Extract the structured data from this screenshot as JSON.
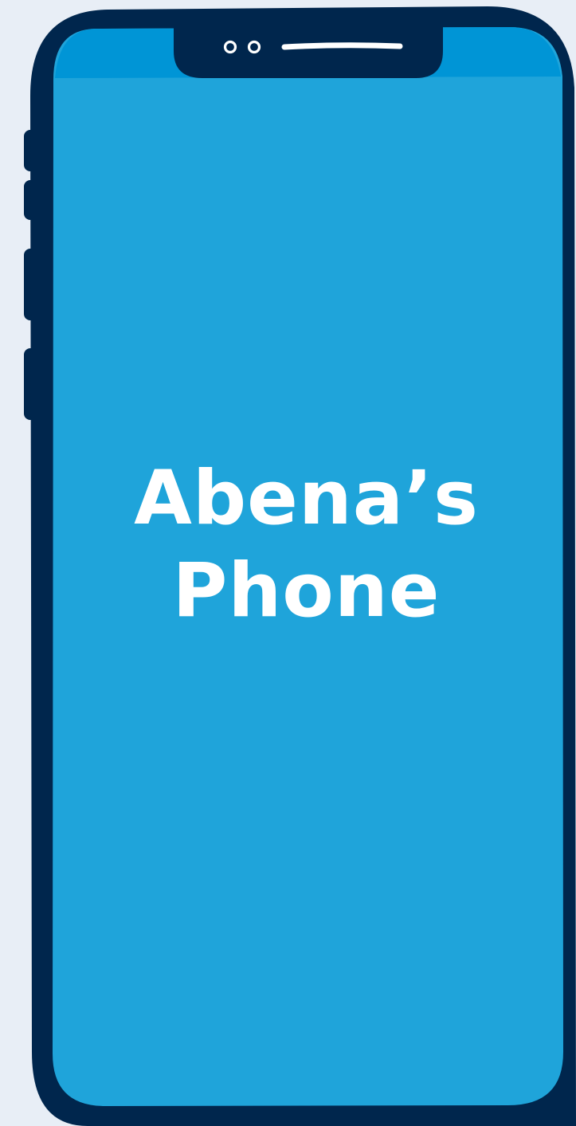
{
  "screen": {
    "title_line1": "Abena’s",
    "title_line2": "Phone"
  },
  "icons": {
    "camera": "camera-lens-icon",
    "speaker": "speaker-grille-icon"
  },
  "colors": {
    "background": "#e8eef6",
    "frame": "#00264d",
    "screen": "#1fa4da",
    "screen_top_highlight": "#0095d6",
    "text": "#ffffff"
  }
}
